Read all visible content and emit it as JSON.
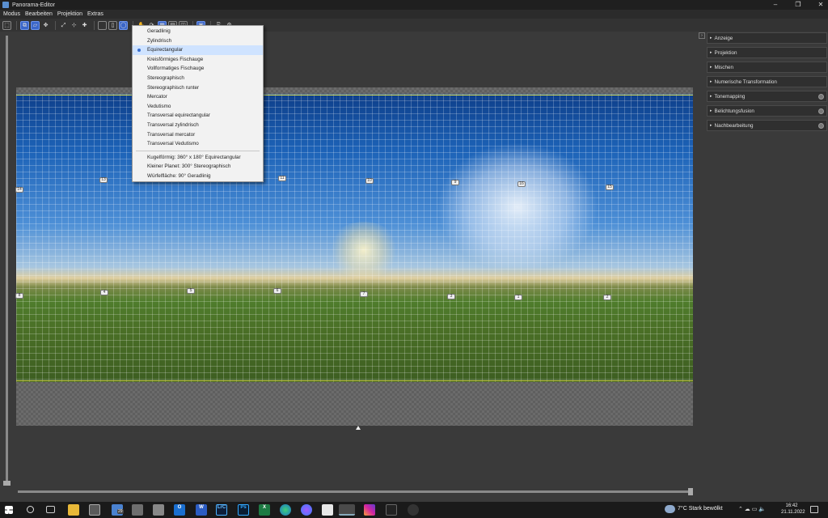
{
  "window": {
    "title": "Panorama-Editor",
    "app_icon": "panorama-app-icon",
    "controls": [
      "–",
      "❐",
      "✕"
    ]
  },
  "menubar": [
    "Modus",
    "Bearbeiten",
    "Projektion",
    "Extras"
  ],
  "toolbar_icons": [
    "crop-icon",
    "layers-icon",
    "layers-active-icon",
    "move-icon",
    "fit-icon",
    "center-icon",
    "straighten-icon",
    "rect-view-icon",
    "cylinder-view-icon",
    "sphere-view-icon",
    "pan-icon",
    "rotate-icon",
    "preview-icon",
    "grid-icon",
    "compare-icon",
    "overlay-icon",
    "export-icon",
    "settings-icon"
  ],
  "projection_menu": {
    "selected": "Equirectangular",
    "items": [
      "Geradlinig",
      "Zylindrisch",
      "Equirectangular",
      "Kreisförmiges Fischauge",
      "Vollformatiges Fischauge",
      "Stereographisch",
      "Stereographisch runter",
      "Mercator",
      "Vedutismo",
      "Transversal equirectangular",
      "Transversal zylindrisch",
      "Transversal mercator",
      "Transversal Vedutismo"
    ],
    "presets": [
      "Kugelförmig: 360° x 180° Equirectangular",
      "Kleiner Planet: 300° Stereographisch",
      "Würfelfläche: 90° Geradlinig"
    ]
  },
  "control_points": [
    "14",
    "13",
    "11",
    "10",
    "9",
    "16",
    "15",
    "8",
    "4",
    "5",
    "6",
    "7",
    "3",
    "1",
    "2"
  ],
  "panels": [
    {
      "label": "Anzeige",
      "has_toggle": false
    },
    {
      "label": "Projektion",
      "has_toggle": false
    },
    {
      "label": "Mischen",
      "has_toggle": false
    },
    {
      "label": "Numerische Transformation",
      "has_toggle": false
    },
    {
      "label": "Tonemapping",
      "has_toggle": true
    },
    {
      "label": "Belichtungsfusion",
      "has_toggle": true
    },
    {
      "label": "Nachbearbeitung",
      "has_toggle": true
    }
  ],
  "taskbar": {
    "apps": [
      "windows-start-icon",
      "search-icon",
      "task-view-icon",
      "file-explorer-icon",
      "store-icon",
      "mail-icon",
      "teams-icon",
      "calculator-icon",
      "outlook-icon",
      "word-icon",
      "lightroom-icon",
      "photoshop-icon",
      "excel-icon",
      "edge-icon",
      "messenger-icon",
      "affinity-icon",
      "panorama-editor-icon",
      "instagram-icon",
      "app-icon",
      "copilot-icon"
    ],
    "badge": "29",
    "labels": {
      "word": "W",
      "lightroom": "LrC",
      "photoshop": "Ps",
      "excel": "X",
      "outlook": "O"
    },
    "weather": "7°C  Stark bewölkt",
    "time": "16:42",
    "date": "21.11.2022"
  },
  "colors": {
    "accent": "#3b66c9",
    "menu_selected": "#cfe3ff",
    "horizon": "#d8d84a"
  }
}
